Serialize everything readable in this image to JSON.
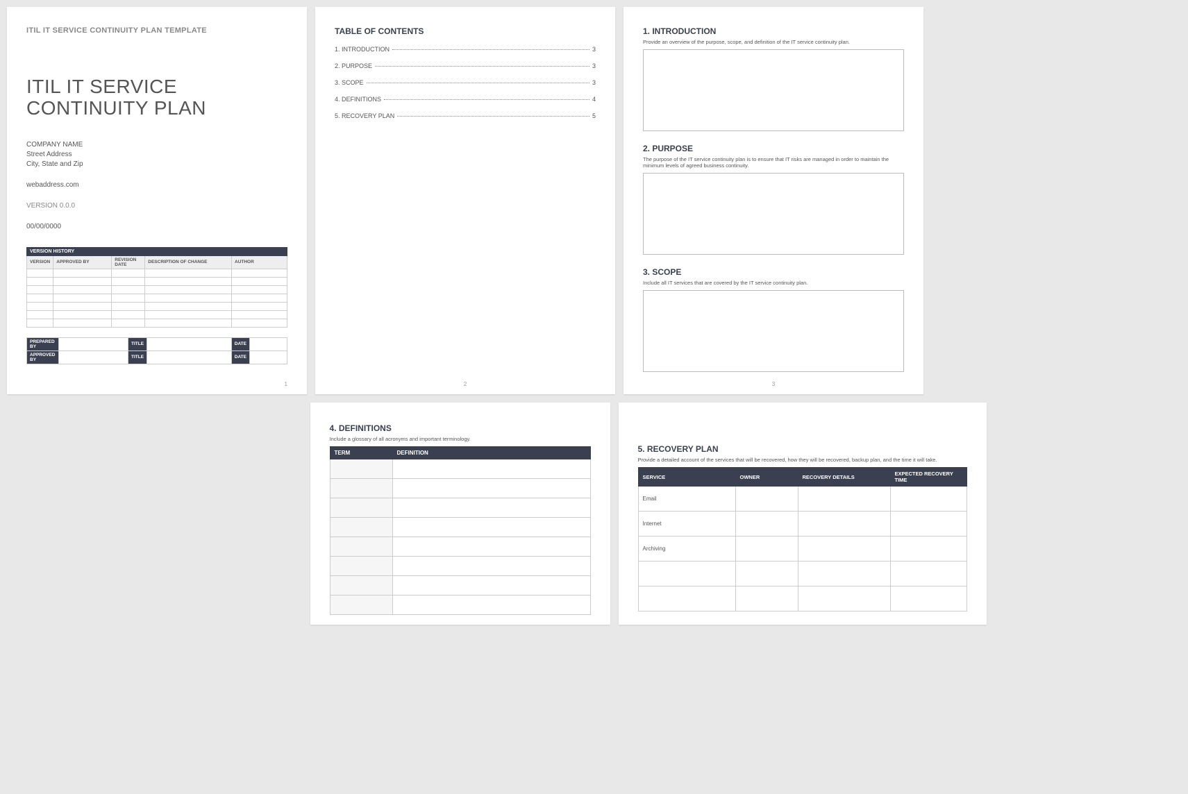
{
  "page1": {
    "templateHeader": "ITIL IT SERVICE CONTINUITY PLAN TEMPLATE",
    "docTitle1": "ITIL IT SERVICE",
    "docTitle2": "CONTINUITY PLAN",
    "company": "COMPANY NAME",
    "street": "Street Address",
    "cityzip": "City, State and Zip",
    "web": "webaddress.com",
    "version": "VERSION 0.0.0",
    "date": "00/00/0000",
    "vhTitle": "VERSION HISTORY",
    "vhHeaders": [
      "VERSION",
      "APPROVED BY",
      "REVISION DATE",
      "DESCRIPTION OF CHANGE",
      "AUTHOR"
    ],
    "prep": {
      "prepBy": "PREPARED BY",
      "title": "TITLE",
      "date": "DATE",
      "apprBy": "APPROVED BY"
    },
    "pageNum": "1"
  },
  "page2": {
    "tocTitle": "TABLE OF CONTENTS",
    "items": [
      {
        "label": "1. INTRODUCTION",
        "pg": "3"
      },
      {
        "label": "2. PURPOSE",
        "pg": "3"
      },
      {
        "label": "3. SCOPE",
        "pg": "3"
      },
      {
        "label": "4. DEFINITIONS",
        "pg": "4"
      },
      {
        "label": "5. RECOVERY PLAN",
        "pg": "5"
      }
    ],
    "pageNum": "2"
  },
  "page3": {
    "s1": {
      "title": "1.  INTRODUCTION",
      "desc": "Provide an overview of the purpose, scope, and definition of the IT service continuity plan."
    },
    "s2": {
      "title": "2.  PURPOSE",
      "desc": "The purpose of the IT service continuity plan is to ensure that IT risks are managed in order to maintain the minimum levels of agreed business continuity."
    },
    "s3": {
      "title": "3.  SCOPE",
      "desc": "Include all IT services that are covered by the IT service continuity plan."
    },
    "pageNum": "3"
  },
  "page4": {
    "title": "4.  DEFINITIONS",
    "desc": "Include a glossary of all acronyms and important terminology.",
    "headers": [
      "TERM",
      "DEFINITION"
    ]
  },
  "page5": {
    "title": "5.  RECOVERY PLAN",
    "desc": "Provide a detailed account of the services that will be recovered, how they will be recovered, backup plan, and the time it will take.",
    "headers": [
      "SERVICE",
      "OWNER",
      "RECOVERY DETAILS",
      "EXPECTED RECOVERY TIME"
    ],
    "rows": [
      "Email",
      "Internet",
      "Archiving",
      "",
      ""
    ]
  }
}
